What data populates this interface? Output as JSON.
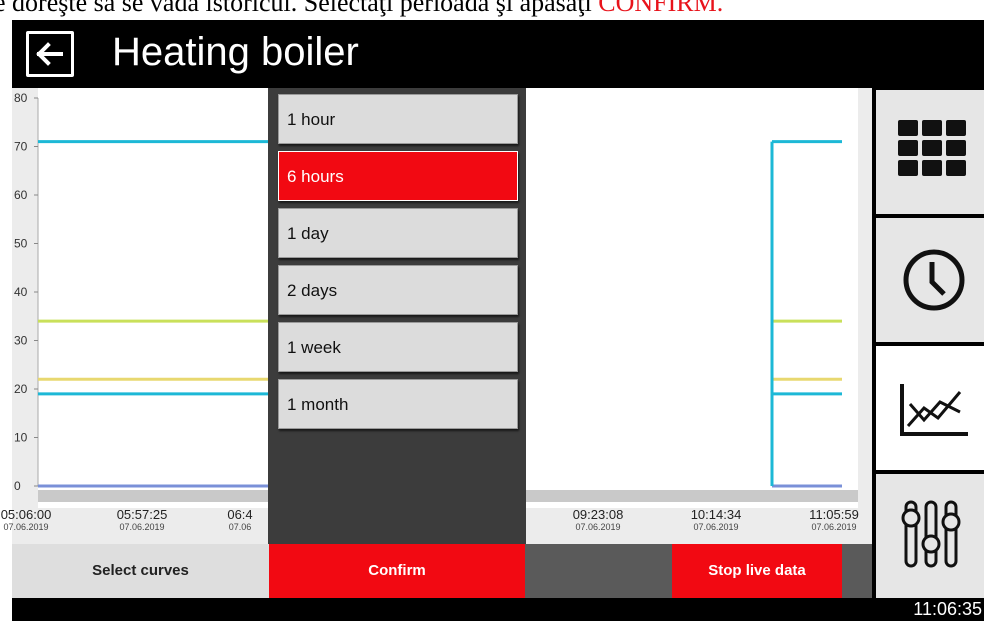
{
  "instruction": {
    "text": "e doreşte să se vadă istoricul. Selectaţi perioada şi apăsaţi ",
    "highlight": "CONFIRM."
  },
  "header": {
    "title": "Heating boiler",
    "back_icon": "arrow-left-icon"
  },
  "chart": {
    "y_ticks": [
      "80",
      "70",
      "60",
      "50",
      "40",
      "30",
      "20",
      "10",
      "0"
    ],
    "x_ticks": [
      {
        "time": "05:06:00",
        "date": "07.06.2019"
      },
      {
        "time": "05:57:25",
        "date": "07.06.2019"
      },
      {
        "time": "06:4",
        "date": "07.06"
      },
      {
        "time": "09:23:08",
        "date": "07.06.2019"
      },
      {
        "time": "10:14:34",
        "date": "07.06.2019"
      },
      {
        "time": "11:05:59",
        "date": "07.06.2019"
      }
    ]
  },
  "chart_data": {
    "type": "line",
    "ylim": [
      0,
      80
    ],
    "series": [
      {
        "color": "#1cb8d6",
        "values": [
          71,
          71,
          71
        ]
      },
      {
        "color": "#c9e05a",
        "values": [
          34,
          34,
          34
        ]
      },
      {
        "color": "#e8d870",
        "values": [
          22,
          22,
          22
        ]
      },
      {
        "color": "#1cb8d6",
        "values": [
          19,
          19,
          19
        ]
      },
      {
        "color": "#7a90d8",
        "values": [
          0,
          0,
          0
        ]
      }
    ]
  },
  "period_menu": {
    "options": [
      "1 hour",
      "6 hours",
      "1 day",
      "2 days",
      "1 week",
      "1 month"
    ],
    "selected": "6 hours"
  },
  "bottom": {
    "select_curves": "Select curves",
    "confirm": "Confirm",
    "stop_live": "Stop live data"
  },
  "sidebar": {
    "icons": [
      "grid-icon",
      "clock-icon",
      "chart-icon",
      "sliders-icon"
    ],
    "active": "chart-icon"
  },
  "status": {
    "time": "11:06:35"
  },
  "colors": {
    "accent": "#f20912",
    "cyan": "#1cb8d6",
    "lime": "#c9e05a",
    "yellow": "#e8d870"
  }
}
